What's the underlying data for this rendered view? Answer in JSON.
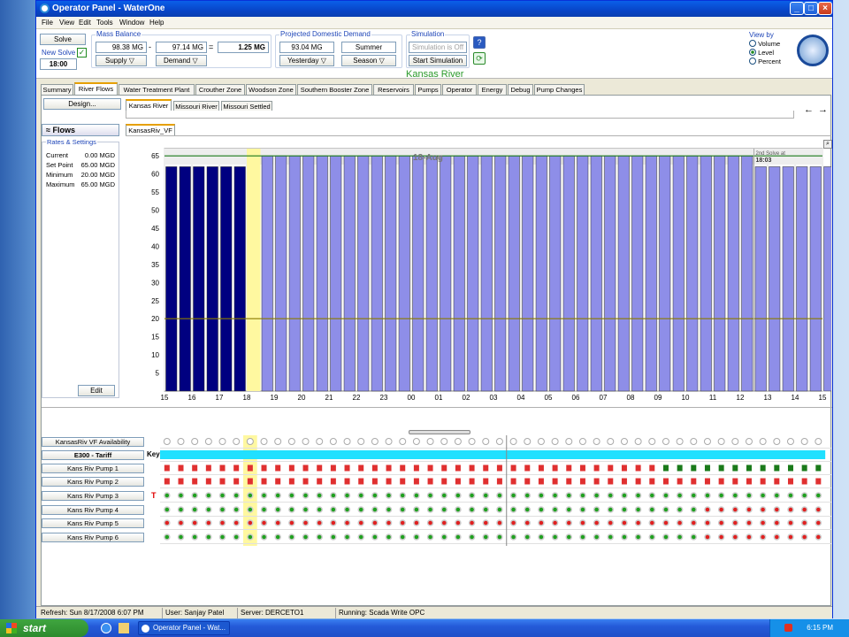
{
  "window": {
    "title": "Operator Panel - WaterOne"
  },
  "menu": [
    "File",
    "View",
    "Edit",
    "Tools",
    "Window",
    "Help"
  ],
  "toolbar": {
    "solve": "Solve",
    "new_solve": "New Solve",
    "time": "18:00",
    "mass_balance_title": "Mass Balance",
    "supply_value": "98.38 MG",
    "minus": "-",
    "demand_value": "97.14 MG",
    "equals": "=",
    "balance_value": "1.25 MG",
    "supply_btn": "Supply",
    "demand_btn": "Demand",
    "projected_title": "Projected Domestic Demand",
    "projected_value": "93.04 MG",
    "season_value": "Summer",
    "yesterday_btn": "Yesterday",
    "season_btn": "Season",
    "simulation_title": "Simulation",
    "simulation_status": "Simulation is Off",
    "start_simulation": "Start Simulation",
    "location": "Kansas River",
    "viewby_title": "View by",
    "viewby_options": [
      "Volume",
      "Level",
      "Percent"
    ],
    "viewby_selected": "Level"
  },
  "tabs": [
    "Summary",
    "River Flows",
    "Water Treatment Plant",
    "Crouther Zone",
    "Woodson Zone",
    "Southern Booster Zone",
    "Reservoirs",
    "Pumps",
    "Operator",
    "Energy",
    "Debug",
    "Pump Changes"
  ],
  "tab_selected": "River Flows",
  "design_btn": "Design...",
  "subtabs": [
    "Kansas River",
    "Missouri River",
    "Missouri Settled"
  ],
  "chart_tab": "KansasRiv_VF",
  "arrows": {
    "back": "←",
    "forward": "→"
  },
  "left": {
    "flows": "Flows",
    "rates_title": "Rates & Settings",
    "rows": [
      [
        "Current",
        "0.00 MGD"
      ],
      [
        "Set Point",
        "65.00 MGD"
      ],
      [
        "Minimum",
        "20.00 MGD"
      ],
      [
        "Maximum",
        "65.00 MGD"
      ]
    ],
    "edit": "Edit"
  },
  "chart_data": {
    "type": "bar",
    "date_label": "18-Aug",
    "annotation": "2nd Solve at\n18:03",
    "x_ticks": [
      "15",
      "16",
      "17",
      "18",
      "19",
      "20",
      "21",
      "22",
      "23",
      "00",
      "01",
      "02",
      "03",
      "04",
      "05",
      "06",
      "07",
      "08",
      "09",
      "10",
      "11",
      "12",
      "13",
      "14",
      "15"
    ],
    "y_ticks": [
      5,
      10,
      15,
      20,
      25,
      30,
      35,
      40,
      45,
      50,
      55,
      60,
      65
    ],
    "ylim": [
      0,
      67
    ],
    "setpoint_max": 65,
    "setpoint_min": 20,
    "history_values": [
      62,
      62,
      62,
      62,
      62,
      62
    ],
    "forecast_values": [
      65,
      65,
      65,
      65,
      65,
      65,
      65,
      65,
      65,
      65,
      65,
      65,
      65,
      65,
      65,
      65,
      65,
      65,
      65,
      65,
      65,
      65,
      65,
      65,
      65,
      65,
      65,
      65,
      65,
      65,
      65,
      65,
      65,
      65,
      65,
      65,
      62,
      62,
      62,
      62,
      62,
      62,
      62,
      62,
      62,
      62,
      62,
      62
    ],
    "history_color": "#000080",
    "forecast_color": "#8e8ee8",
    "current_slot_color": "#fff8a0"
  },
  "bottom": {
    "key": "Key",
    "rows": [
      "KansasRiv VF Availability",
      "E300 - Tariff",
      "Kans Riv Pump 1",
      "Kans Riv Pump 2",
      "Kans Riv Pump 3",
      "Kans Riv Pump 4",
      "Kans Riv Pump 5",
      "Kans Riv Pump 6"
    ],
    "pump3_marker": "T"
  },
  "status": {
    "refresh": "Refresh: Sun 8/17/2008 6:07 PM",
    "user": "User: Sanjay Patel",
    "server": "Server: DERCETO1",
    "running": "Running: Scada Write OPC"
  },
  "taskbar": {
    "start": "start",
    "task": "Operator Panel - Wat...",
    "clock": "6:15 PM"
  }
}
